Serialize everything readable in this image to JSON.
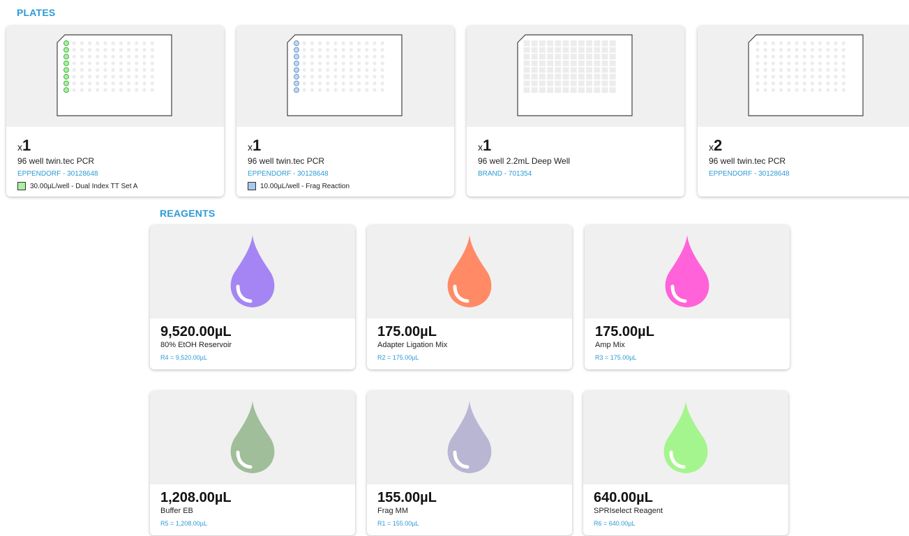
{
  "sections": {
    "plates": "PLATES",
    "reagents": "REAGENTS"
  },
  "plates": [
    {
      "qty_prefix": "x",
      "qty": "1",
      "name": "96 well  twin.tec PCR",
      "brand": "EPPENDORF - 30128648",
      "contents": "30.00µL/well - Dual Index TT Set A",
      "swatch_color": "#a9f0a0",
      "filled_col_color": "#a9f0a0",
      "filled_col_stroke": "#3aa83a",
      "plate_type": "pcr"
    },
    {
      "qty_prefix": "x",
      "qty": "1",
      "name": "96 well  twin.tec PCR",
      "brand": "EPPENDORF - 30128648",
      "contents": "10.00µL/well - Frag Reaction",
      "swatch_color": "#a8c8ee",
      "filled_col_color": "#c4d8f2",
      "filled_col_stroke": "#5a8cc8",
      "plate_type": "pcr"
    },
    {
      "qty_prefix": "x",
      "qty": "1",
      "name": "96 well  2.2mL Deep Well",
      "brand": "BRAND - 701354",
      "contents": "",
      "plate_type": "deepwell"
    },
    {
      "qty_prefix": "x",
      "qty": "2",
      "name": "96 well  twin.tec PCR",
      "brand": "EPPENDORF - 30128648",
      "contents": "",
      "plate_type": "pcr"
    }
  ],
  "reagents": [
    {
      "volume": "9,520.00µL",
      "name": "80% EtOH Reservoir",
      "location": "R4 = 9,520.00µL",
      "color": "#a585f3"
    },
    {
      "volume": "175.00µL",
      "name": "Adapter Ligation Mix",
      "location": "R2 = 175.00µL",
      "color": "#ff8a65"
    },
    {
      "volume": "175.00µL",
      "name": "Amp Mix",
      "location": "R3 = 175.00µL",
      "color": "#ff62d9"
    },
    {
      "volume": "1,208.00µL",
      "name": "Buffer EB",
      "location": "R5 = 1,208.00µL",
      "color": "#9fbe99"
    },
    {
      "volume": "155.00µL",
      "name": "Frag MM",
      "location": "R1 = 155.00µL",
      "color": "#b9b6d4"
    },
    {
      "volume": "640.00µL",
      "name": "SPRIselect Reagent",
      "location": "R6 = 640.00µL",
      "color": "#a5f58e"
    }
  ]
}
